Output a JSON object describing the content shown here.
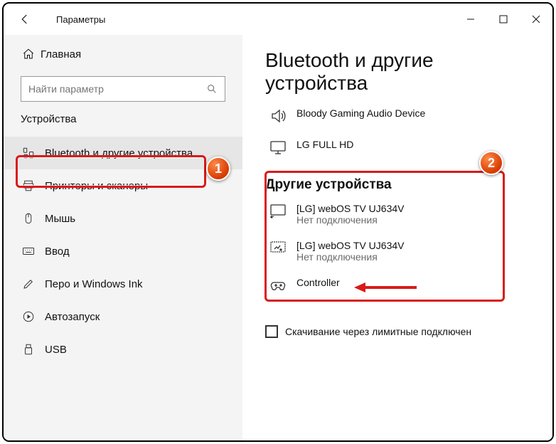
{
  "titlebar": {
    "title": "Параметры"
  },
  "sidebar": {
    "home": "Главная",
    "search_placeholder": "Найти параметр",
    "section": "Устройства",
    "items": [
      {
        "label": "Bluetooth и другие устройства"
      },
      {
        "label": "Принтеры и сканеры"
      },
      {
        "label": "Мышь"
      },
      {
        "label": "Ввод"
      },
      {
        "label": "Перо и Windows Ink"
      },
      {
        "label": "Автозапуск"
      },
      {
        "label": "USB"
      }
    ]
  },
  "main": {
    "heading": "Bluetooth и другие устройства",
    "audio_section": [
      {
        "name": "Bloody Gaming Audio Device"
      },
      {
        "name": "LG FULL HD"
      }
    ],
    "other_heading": "Другие устройства",
    "other_devices": [
      {
        "name": "[LG] webOS TV UJ634V",
        "status": "Нет подключения"
      },
      {
        "name": "[LG] webOS TV UJ634V",
        "status": "Нет подключения"
      },
      {
        "name": "Controller",
        "status": ""
      }
    ],
    "checkbox_label": "Скачивание через лимитные подключен"
  },
  "annotations": {
    "badge1": "1",
    "badge2": "2"
  }
}
